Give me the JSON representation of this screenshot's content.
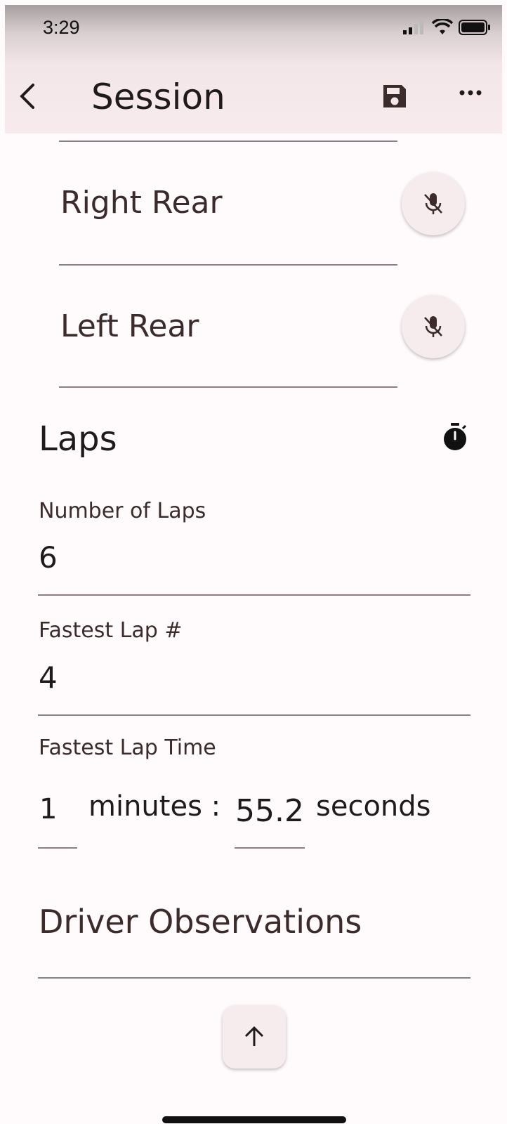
{
  "status_bar": {
    "time": "3:29"
  },
  "app_bar": {
    "title": "Session",
    "back_icon": "chevron-left-icon",
    "save_icon": "save-icon",
    "more_icon": "more-horizontal-icon"
  },
  "tires": [
    {
      "label": "Right Rear",
      "icon": "mic-off-icon"
    },
    {
      "label": "Left Rear",
      "icon": "mic-off-icon"
    }
  ],
  "laps": {
    "title": "Laps",
    "icon": "stopwatch-icon",
    "number_of_laps": {
      "label": "Number of Laps",
      "value": "6"
    },
    "fastest_lap_number": {
      "label": "Fastest Lap #",
      "value": "4"
    },
    "fastest_lap_time": {
      "label": "Fastest Lap Time",
      "minutes_value": "1",
      "minutes_unit": "minutes :",
      "seconds_value": "55.2",
      "seconds_unit": "seconds"
    }
  },
  "driver_observations": {
    "title": "Driver Observations"
  },
  "scroll_top_icon": "arrow-up-icon",
  "colors": {
    "background": "#fffbfd",
    "app_bar": "#f8ebed",
    "text": "#3b2b2b",
    "divider": "#8d7f80"
  }
}
